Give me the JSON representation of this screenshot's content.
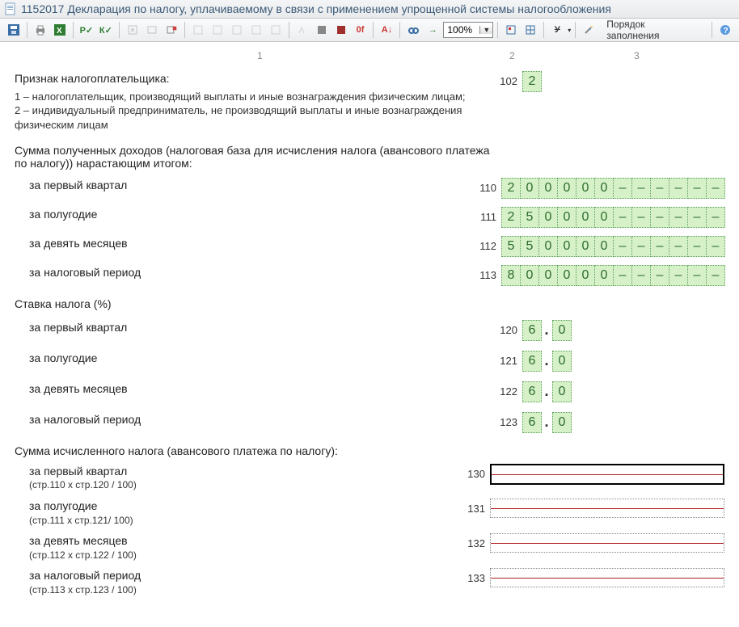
{
  "window": {
    "title": "1152017 Декларация по налогу, уплачиваемому в связи с применением упрощенной системы налогообложения"
  },
  "toolbar": {
    "zoom": "100%",
    "order_button": "Порядок заполнения"
  },
  "ruler": {
    "c1": "1",
    "c2": "2",
    "c3": "3"
  },
  "section_sign": {
    "title": "Признак налогоплательщика:",
    "line1": "1 – налогоплательщик, производящий выплаты и иные вознаграждения физическим лицам;",
    "line2": "2 – индивидуальный предприниматель, не производящий выплаты и иные вознаграждения физическим лицам",
    "code": "102",
    "value": "2"
  },
  "section_income": {
    "title": "Сумма полученных доходов (налоговая база для исчисления налога (авансового платежа по налогу)) нарастающим итогом:",
    "rows": [
      {
        "label": "за первый квартал",
        "code": "110",
        "digits": [
          "2",
          "0",
          "0",
          "0",
          "0",
          "0",
          "–",
          "–",
          "–",
          "–",
          "–",
          "–"
        ]
      },
      {
        "label": "за полугодие",
        "code": "111",
        "digits": [
          "2",
          "5",
          "0",
          "0",
          "0",
          "0",
          "–",
          "–",
          "–",
          "–",
          "–",
          "–"
        ]
      },
      {
        "label": "за девять месяцев",
        "code": "112",
        "digits": [
          "5",
          "5",
          "0",
          "0",
          "0",
          "0",
          "–",
          "–",
          "–",
          "–",
          "–",
          "–"
        ]
      },
      {
        "label": "за налоговый период",
        "code": "113",
        "digits": [
          "8",
          "0",
          "0",
          "0",
          "0",
          "0",
          "–",
          "–",
          "–",
          "–",
          "–",
          "–"
        ]
      }
    ]
  },
  "section_rate": {
    "title": "Ставка налога (%)",
    "rows": [
      {
        "label": "за первый квартал",
        "code": "120",
        "int": "6",
        "frac": "0"
      },
      {
        "label": "за полугодие",
        "code": "121",
        "int": "6",
        "frac": "0"
      },
      {
        "label": "за девять месяцев",
        "code": "122",
        "int": "6",
        "frac": "0"
      },
      {
        "label": "за налоговый период",
        "code": "123",
        "int": "6",
        "frac": "0"
      }
    ]
  },
  "section_calc": {
    "title": "Сумма исчисленного налога (авансового платежа по налогу):",
    "rows": [
      {
        "label": "за первый квартал",
        "hint": "(стр.110 х стр.120 / 100)",
        "code": "130",
        "focused": true
      },
      {
        "label": "за полугодие",
        "hint": "(стр.111 х стр.121/ 100)",
        "code": "131",
        "focused": false
      },
      {
        "label": "за девять месяцев",
        "hint": "(стр.112 х стр.122 / 100)",
        "code": "132",
        "focused": false
      },
      {
        "label": "за налоговый период",
        "hint": "(стр.113 х стр.123 / 100)",
        "code": "133",
        "focused": false
      }
    ]
  }
}
